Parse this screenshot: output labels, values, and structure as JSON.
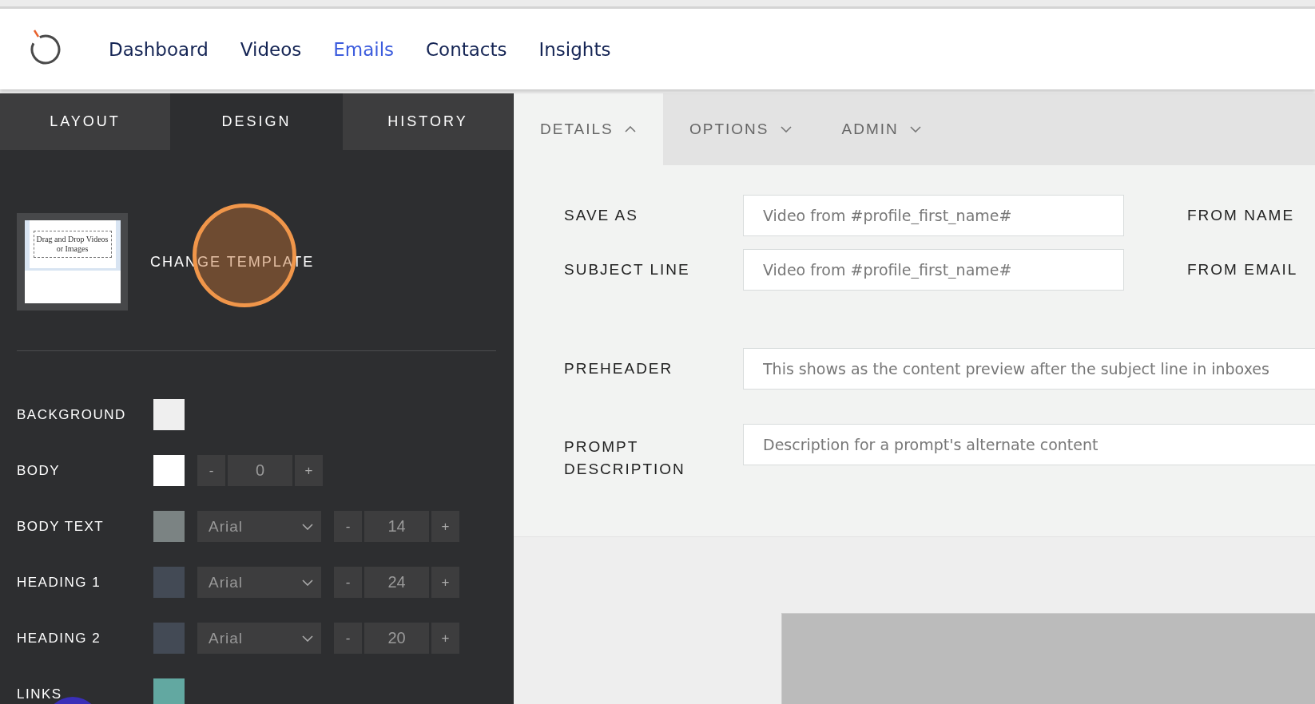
{
  "nav": {
    "items": [
      {
        "label": "Dashboard",
        "selected": false
      },
      {
        "label": "Videos",
        "selected": false
      },
      {
        "label": "Emails",
        "selected": true
      },
      {
        "label": "Contacts",
        "selected": false
      },
      {
        "label": "Insights",
        "selected": false
      }
    ]
  },
  "panel_tabs": [
    {
      "label": "LAYOUT",
      "selected": false
    },
    {
      "label": "DESIGN",
      "selected": true
    },
    {
      "label": "HISTORY",
      "selected": false
    }
  ],
  "template": {
    "thumbnail_text": "Drag and Drop Videos or Images",
    "button": "CHANGE TEMPLATE"
  },
  "design_rows": [
    {
      "kind": "color",
      "label": "BACKGROUND",
      "color": "#efefef"
    },
    {
      "kind": "spacing",
      "label": "BODY",
      "color": "#ffffff",
      "minus": "-",
      "value": "0",
      "plus": "+"
    },
    {
      "kind": "font",
      "label": "BODY TEXT",
      "color": "#7b8383",
      "font": "Arial",
      "minus": "-",
      "size": "14",
      "plus": "+"
    },
    {
      "kind": "font",
      "label": "HEADING 1",
      "color": "#434a55",
      "font": "Arial",
      "minus": "-",
      "size": "24",
      "plus": "+"
    },
    {
      "kind": "font",
      "label": "HEADING 2",
      "color": "#434a55",
      "font": "Arial",
      "minus": "-",
      "size": "20",
      "plus": "+"
    },
    {
      "kind": "color",
      "label": "LINKS",
      "color": "#62a8a1"
    }
  ],
  "details_tabs": [
    {
      "label": "DETAILS",
      "selected": true,
      "expanded": true
    },
    {
      "label": "OPTIONS",
      "selected": false,
      "expanded": false
    },
    {
      "label": "ADMIN",
      "selected": false,
      "expanded": false
    }
  ],
  "details": {
    "rows": [
      {
        "label": "SAVE AS",
        "placeholder": "Video from #profile_first_name#",
        "side_label": "FROM NAME"
      },
      {
        "label": "SUBJECT LINE",
        "placeholder": "Video from #profile_first_name#",
        "side_label": "FROM EMAIL"
      },
      {
        "label": "PREHEADER",
        "placeholder": "This shows as the content preview after the subject line in inboxes"
      },
      {
        "label": "PROMPT DESCRIPTION",
        "placeholder": "Description for a prompt's alternate content"
      }
    ]
  }
}
